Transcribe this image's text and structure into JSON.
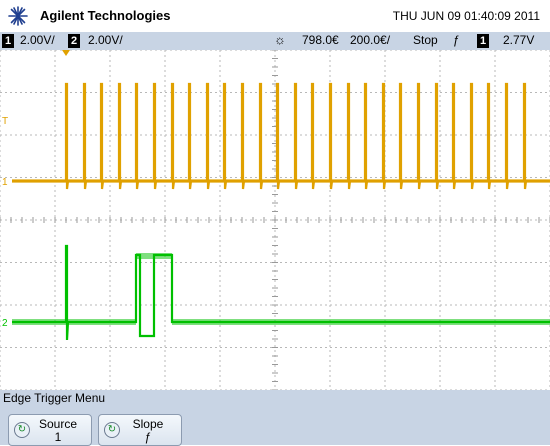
{
  "header": {
    "brand": "Agilent Technologies",
    "datetime": "THU JUN 09 01:40:09 2011"
  },
  "statusbar": {
    "ch1_num": "1",
    "ch1_scale": "2.00V/",
    "ch2_num": "2",
    "ch2_scale": "2.00V/",
    "time_offset": "798.0€",
    "time_scale": "200.0€/",
    "run_state": "Stop",
    "trigger_slope_glyph": "ƒ",
    "trig_source_num": "1",
    "trigger_level": "2.77V"
  },
  "screen": {
    "ch1_color": "#e0a100",
    "ch2_color": "#00c000",
    "trig_level_marker": "T",
    "ch1_marker": "1",
    "ch2_marker": "2"
  },
  "menu": {
    "title": "Edge Trigger Menu",
    "softkeys": [
      {
        "label": "Source",
        "value": "1",
        "icon": "knob-arrow-icon"
      },
      {
        "label": "Slope",
        "value": "ƒ",
        "icon": "knob-arrow-icon"
      }
    ]
  }
}
